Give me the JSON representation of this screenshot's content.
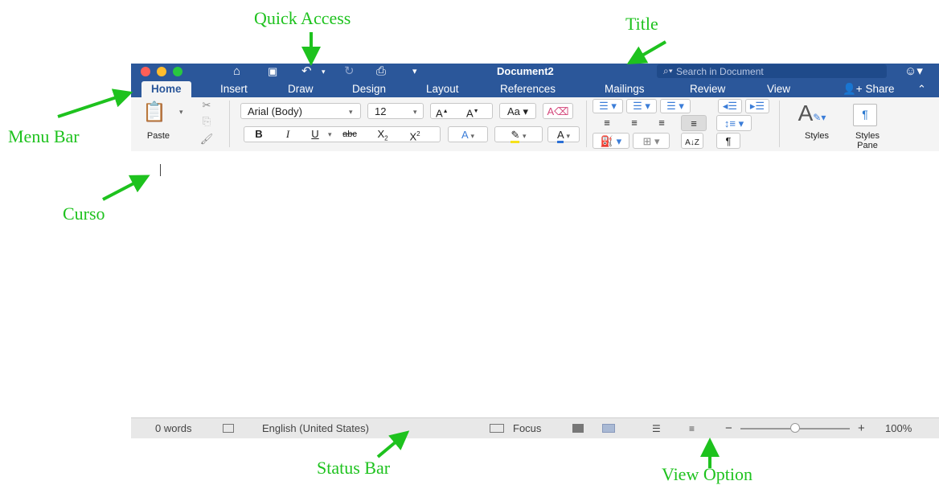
{
  "annotations": {
    "quick_access": "Quick Access",
    "title": "Title",
    "menu_bar": "Menu Bar",
    "cursor": "Curso",
    "status_bar": "Status Bar",
    "view_option": "View Option"
  },
  "window": {
    "title": "Document2",
    "search_placeholder": "Search in Document"
  },
  "tabs": [
    "Home",
    "Insert",
    "Draw",
    "Design",
    "Layout",
    "References",
    "Mailings",
    "Review",
    "View"
  ],
  "share_label": "Share",
  "ribbon": {
    "paste_label": "Paste",
    "font_name": "Arial (Body)",
    "font_size": "12",
    "bold": "B",
    "italic": "I",
    "underline": "U",
    "strikethrough": "abc",
    "styles_label": "Styles",
    "styles_pane_line1": "Styles",
    "styles_pane_line2": "Pane"
  },
  "status": {
    "words": "0 words",
    "language": "English (United States)",
    "focus": "Focus",
    "zoom_minus": "−",
    "zoom_plus": "+",
    "zoom_percent": "100%",
    "zoom_level": 1.0
  },
  "colors": {
    "brand": "#2b579a",
    "annotation": "#1ec21e",
    "ribbon_bg": "#f4f4f4",
    "status_bg": "#e8e8e8"
  }
}
